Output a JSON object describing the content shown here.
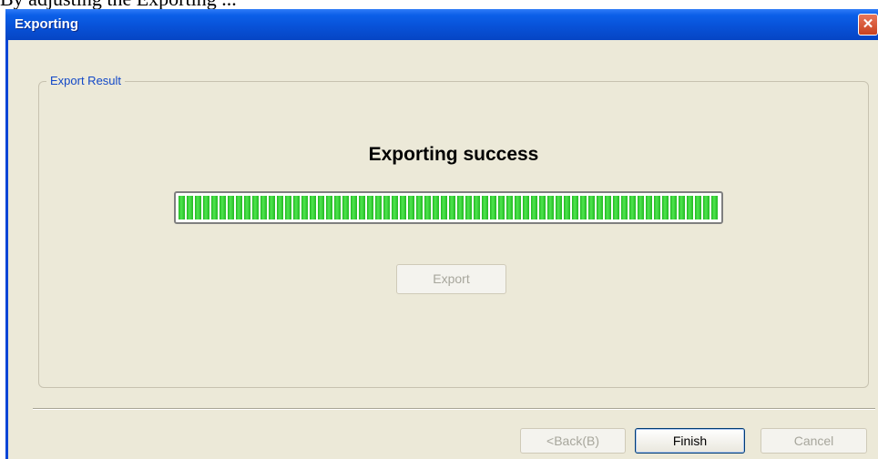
{
  "background_text": "By  adjusting the Exporting  ...",
  "window": {
    "title": "Exporting",
    "close_glyph": "✕"
  },
  "group": {
    "label": "Export Result",
    "status_text": "Exporting success",
    "progress_percent": 100,
    "export_button_label": "Export"
  },
  "footer": {
    "back_label": "<Back(B)",
    "finish_label": "Finish",
    "cancel_label": "Cancel"
  },
  "colors": {
    "titlebar": "#0852d8",
    "progress_green": "#22b922",
    "group_label": "#1248c7"
  }
}
